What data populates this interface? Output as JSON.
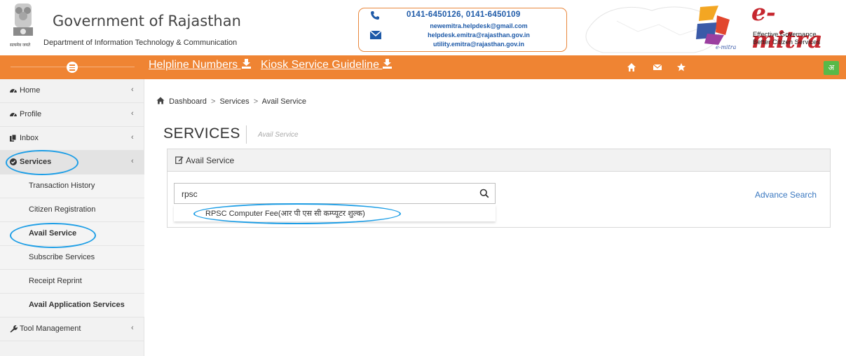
{
  "header": {
    "gov_title": "Government of Rajasthan",
    "dept_title": "Department of Information Technology & Communication",
    "emblem_caption": "सत्यमेव जयते",
    "contact": {
      "phones": "0141-6450126, 0141-6450109",
      "emails": [
        "newemitra.helpdesk@gmail.com",
        "helpdesk.emitra@rajasthan.gov.in",
        "utility.emitra@rajasthan.gov.in"
      ]
    },
    "brand": "e-mitra",
    "tagline_1": "Effective Governance",
    "tagline_2": "Better Citizen Services",
    "colors": {
      "orange": "#ef8433",
      "blue": "#1e5aa8",
      "brand_red": "#c6262e"
    }
  },
  "navbar": {
    "helpline_label": "Helpline Numbers",
    "kiosk_label": "Kiosk Service Guideline",
    "lang_label": "अ",
    "icons": [
      "home-icon",
      "envelope-icon",
      "star-icon"
    ]
  },
  "sidebar": {
    "items": [
      {
        "label": "Home",
        "icon": "dashboard-icon"
      },
      {
        "label": "Profile",
        "icon": "dashboard-icon"
      },
      {
        "label": "Inbox",
        "icon": "copy-icon"
      },
      {
        "label": "Services",
        "icon": "check-circle-icon"
      },
      {
        "label": "Tool Management",
        "icon": "wrench-icon"
      }
    ],
    "sub_items": [
      {
        "label": "Transaction History"
      },
      {
        "label": "Citizen Registration"
      },
      {
        "label": "Avail Service"
      },
      {
        "label": "Subscribe Services"
      },
      {
        "label": "Receipt Reprint"
      },
      {
        "label": "Avail Application Services"
      }
    ]
  },
  "breadcrumb": {
    "items": [
      "Dashboard",
      "Services",
      "Avail Service"
    ],
    "sep_1": ">",
    "sep_2": ">"
  },
  "page": {
    "title": "SERVICES",
    "subtitle": "Avail Service"
  },
  "panel": {
    "title": "Avail Service",
    "search_value": "rpsc",
    "suggestion": "RPSC Computer Fee(आर पी एस सी कम्प्यूटर शुल्क)",
    "advance_search": "Advance Search"
  }
}
